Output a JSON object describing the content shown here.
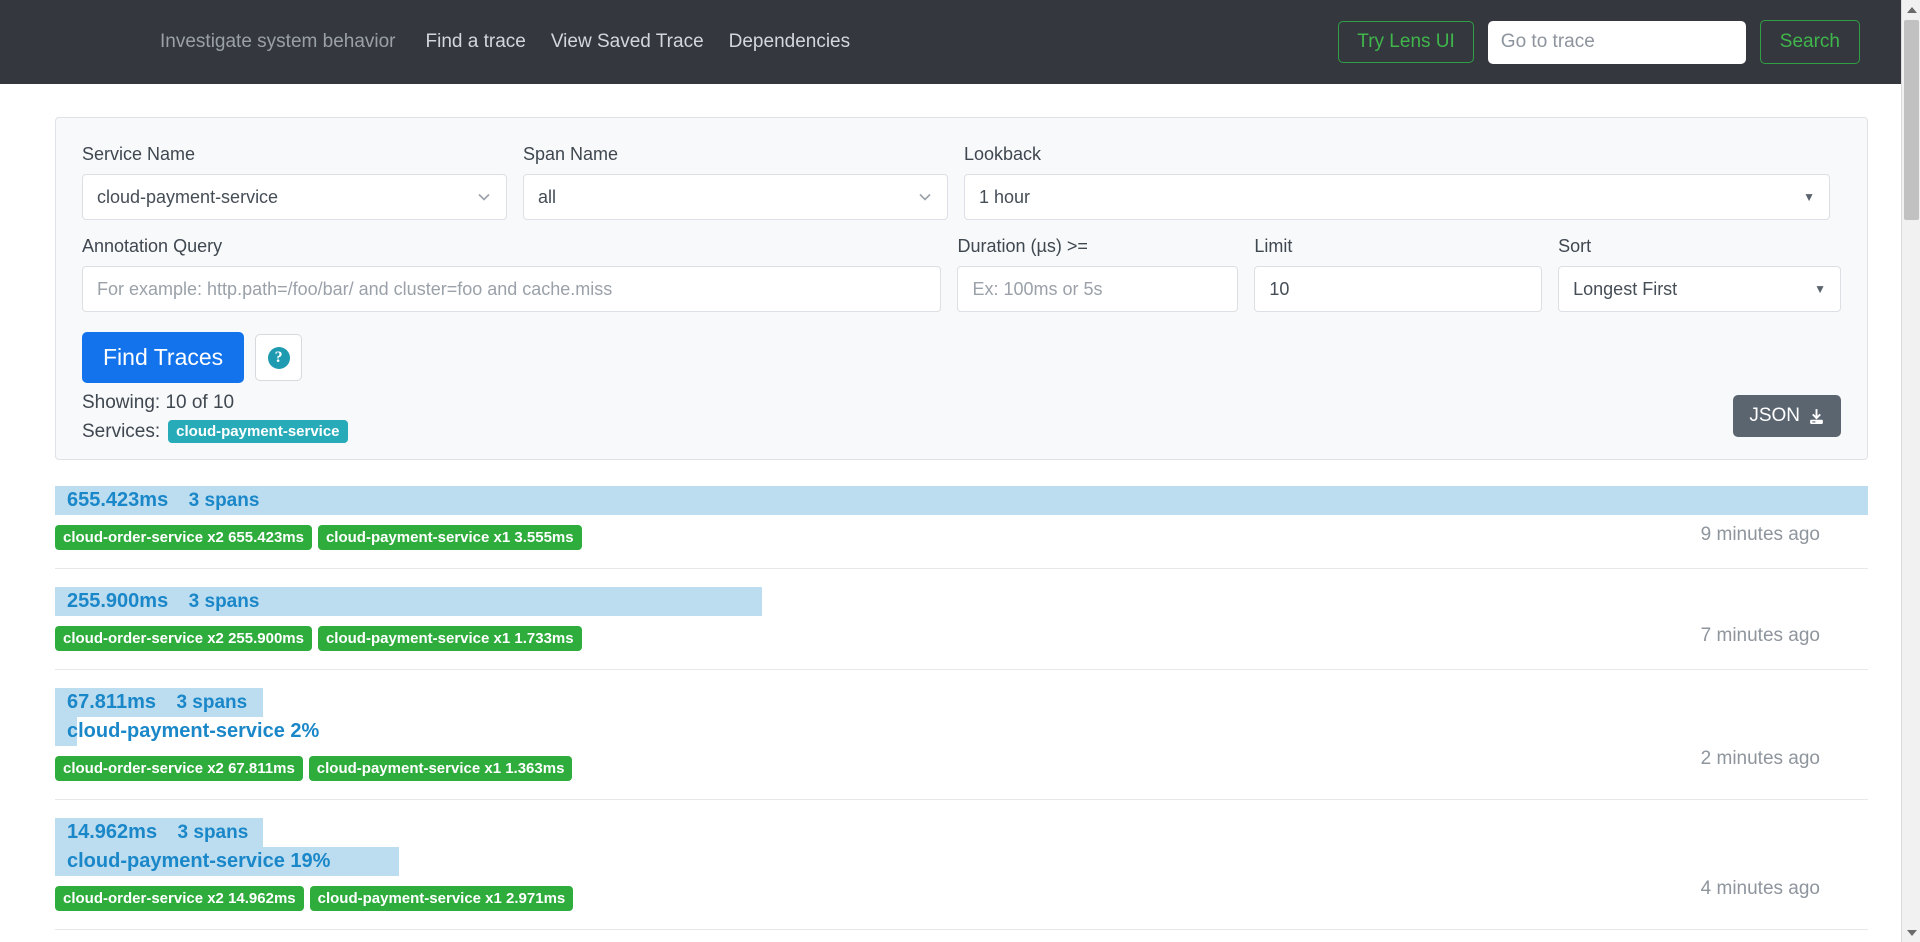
{
  "header": {
    "tagline": "Investigate system behavior",
    "nav_links": [
      {
        "label": "Find a trace"
      },
      {
        "label": "View Saved Trace"
      },
      {
        "label": "Dependencies"
      }
    ],
    "lens_button": "Try Lens UI",
    "goto_trace_placeholder": "Go to trace",
    "goto_trace_value": "",
    "search_button": "Search",
    "background_color": "#34383e",
    "accent_green": "#3fb54b"
  },
  "search_form": {
    "service_name": {
      "label": "Service Name",
      "value": "cloud-payment-service"
    },
    "span_name": {
      "label": "Span Name",
      "value": "all"
    },
    "lookback": {
      "label": "Lookback",
      "value": "1 hour"
    },
    "annotation_query": {
      "label": "Annotation Query",
      "value": "",
      "placeholder": "For example: http.path=/foo/bar/ and cluster=foo and cache.miss"
    },
    "duration": {
      "label": "Duration (µs) >=",
      "value": "",
      "placeholder": "Ex: 100ms or 5s"
    },
    "limit": {
      "label": "Limit",
      "value": "10"
    },
    "sort": {
      "label": "Sort",
      "value": "Longest First"
    },
    "find_traces_button": "Find Traces",
    "help_button": "?",
    "showing_text": "Showing: 10 of 10",
    "services_label": "Services:",
    "services_tags": [
      "cloud-payment-service"
    ],
    "json_button": "JSON",
    "find_button_color": "#1273ec"
  },
  "results": [
    {
      "duration": "655.423ms",
      "spans": "3 spans",
      "percent_line": "",
      "bar_width_pct": 100,
      "pct_bar_width_pct": 0,
      "services": [
        "cloud-order-service x2 655.423ms",
        "cloud-payment-service x1 3.555ms"
      ],
      "time_ago": "9 minutes ago"
    },
    {
      "duration": "255.900ms",
      "spans": "3 spans",
      "percent_line": "",
      "bar_width_pct": 39,
      "pct_bar_width_pct": 0,
      "services": [
        "cloud-order-service x2 255.900ms",
        "cloud-payment-service x1 1.733ms"
      ],
      "time_ago": "7 minutes ago"
    },
    {
      "duration": "67.811ms",
      "spans": "3 spans",
      "percent_line": "cloud-payment-service 2%",
      "bar_width_pct": 12,
      "pct_bar_width_pct": 1.2,
      "services": [
        "cloud-order-service x2 67.811ms",
        "cloud-payment-service x1 1.363ms"
      ],
      "time_ago": "2 minutes ago"
    },
    {
      "duration": "14.962ms",
      "spans": "3 spans",
      "percent_line": "cloud-payment-service 19%",
      "bar_width_pct": 12,
      "pct_bar_width_pct": 19,
      "services": [
        "cloud-order-service x2 14.962ms",
        "cloud-payment-service x1 2.971ms"
      ],
      "time_ago": "4 minutes ago"
    }
  ],
  "scrollbar": {
    "up_arrow": "▲",
    "down_arrow": "▼"
  }
}
